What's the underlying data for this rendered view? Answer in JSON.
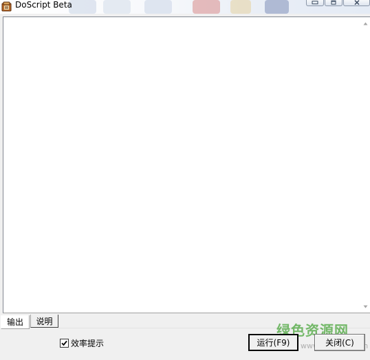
{
  "window": {
    "title": "DoScript Beta",
    "controls": [
      "minimize",
      "maximize",
      "close"
    ]
  },
  "editor": {
    "content": ""
  },
  "tabs": [
    {
      "label": "输出",
      "active": true
    },
    {
      "label": "说明",
      "active": false
    }
  ],
  "options": {
    "efficiency_hint": {
      "label": "效率提示",
      "checked": true
    }
  },
  "buttons": {
    "run": "运行(F9)",
    "close": "关闭(C)"
  },
  "watermark": {
    "text": "绿色资源网",
    "url": "www.downcc.com"
  },
  "colors": {
    "window_bg": "#f0f0f0",
    "editor_bg": "#ffffff",
    "watermark": "#54aa46"
  },
  "icons": {
    "app": "doscript-app-icon",
    "minimize": "minimize-icon",
    "maximize": "maximize-icon",
    "close": "close-icon",
    "scroll_up": "scroll-up-arrow-icon",
    "scroll_down": "scroll-down-arrow-icon",
    "checkbox": "checkmark-icon"
  }
}
